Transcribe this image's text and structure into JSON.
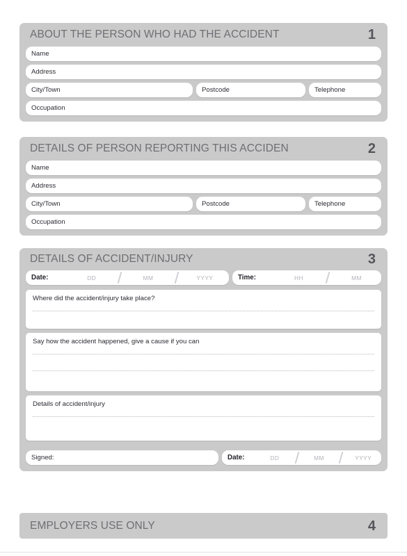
{
  "form": {
    "sections": [
      {
        "id": "about-person",
        "title": "ABOUT THE PERSON WHO HAD THE ACCIDENT",
        "number": "1",
        "fields": {
          "name": "Name",
          "address": "Address",
          "city": "City/Town",
          "postcode": "Postcode",
          "telephone": "Telephone",
          "occupation": "Occupation"
        }
      },
      {
        "id": "reporting-person",
        "title": "DETAILS OF PERSON REPORTING THIS ACCIDEN",
        "number": "2",
        "fields": {
          "name": "Name",
          "address": "Address",
          "city": "City/Town",
          "postcode": "Postcode",
          "telephone": "Telephone",
          "occupation": "Occupation"
        }
      },
      {
        "id": "accident-details",
        "title": "DETAILS OF ACCIDENT/INJURY",
        "number": "3"
      },
      {
        "id": "employers-use",
        "title": "EMPLOYERS USE ONLY",
        "number": "4"
      }
    ],
    "accident": {
      "date_label": "Date:",
      "date_dd": "DD",
      "date_mm": "MM",
      "date_yyyy": "YYYY",
      "time_label": "Time:",
      "time_hh": "HH",
      "time_mm": "MM",
      "where_label": "Where did the accident/injury take place?",
      "how_label": "Say how the accident happened, give a cause if you can",
      "details_label": "Details of accident/injury"
    },
    "signature": {
      "signed_label": "Signed:",
      "date_label": "Date:",
      "date_dd": "DD",
      "date_mm": "MM",
      "date_yyyy": "YYYY"
    }
  },
  "colors": {
    "panel": "#cacaca",
    "field": "#ffffff",
    "title": "#6f6f74",
    "number": "#55555b",
    "label": "#2c2c33",
    "placeholder": "#b3b3ba"
  }
}
